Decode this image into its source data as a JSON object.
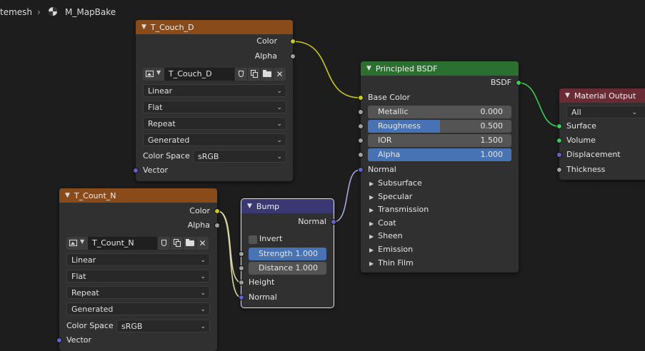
{
  "breadcrumb": {
    "object": "temesh",
    "material": "M_MapBake"
  },
  "colors": {
    "background": "#1d1d1d",
    "node_body": "#303030",
    "texture_header": "#8a4b1b",
    "shader_header": "#2b7030",
    "vector_header": "#3a3873",
    "output_header": "#6b2b35",
    "socket_color": "#c7c729",
    "socket_gray": "#a1a1a1",
    "socket_vector": "#6363c7",
    "socket_shader": "#3fc955",
    "accent": "#4772b3"
  },
  "tex1": {
    "title": "T_Couch_D",
    "out_color": "Color",
    "out_alpha": "Alpha",
    "image": "T_Couch_D",
    "interpolation": "Linear",
    "projection": "Flat",
    "extension": "Repeat",
    "source": "Generated",
    "colorspace_label": "Color Space",
    "colorspace": "sRGB",
    "in_vector": "Vector"
  },
  "tex2": {
    "title": "T_Count_N",
    "out_color": "Color",
    "out_alpha": "Alpha",
    "image": "T_Count_N",
    "interpolation": "Linear",
    "projection": "Flat",
    "extension": "Repeat",
    "source": "Generated",
    "colorspace_label": "Color Space",
    "colorspace": "sRGB",
    "in_vector": "Vector"
  },
  "bump": {
    "title": "Bump",
    "out_normal": "Normal",
    "invert": "Invert",
    "strength_label": "Strength",
    "strength": "1.000",
    "distance_label": "Distance",
    "distance": "1.000",
    "in_height": "Height",
    "in_normal": "Normal"
  },
  "bsdf": {
    "title": "Principled BSDF",
    "out_bsdf": "BSDF",
    "base_color": "Base Color",
    "fields": [
      {
        "label": "Metallic",
        "value": "0.000",
        "fraction": 0.0
      },
      {
        "label": "Roughness",
        "value": "0.500",
        "fraction": 0.5
      },
      {
        "label": "IOR",
        "value": "1.500",
        "fraction": 0.0
      },
      {
        "label": "Alpha",
        "value": "1.000",
        "fraction": 1.0
      }
    ],
    "normal": "Normal",
    "panels": [
      "Subsurface",
      "Specular",
      "Transmission",
      "Coat",
      "Sheen",
      "Emission",
      "Thin Film"
    ]
  },
  "output": {
    "title": "Material Output",
    "target": "All",
    "inputs": [
      "Surface",
      "Volume",
      "Displacement",
      "Thickness"
    ]
  }
}
